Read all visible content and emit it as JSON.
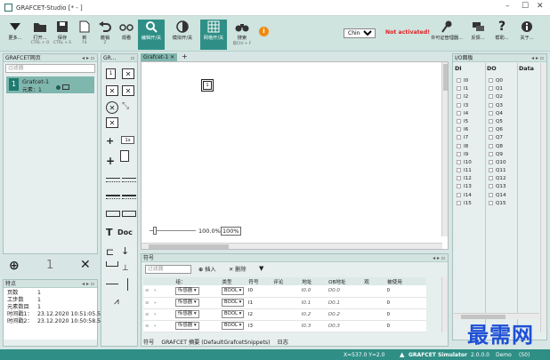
{
  "window": {
    "title": "GRAFCET-Studio [* - ]"
  },
  "toolbar": {
    "more": "更多...",
    "open": "打开...",
    "open_sc": "CTRL + O",
    "save": "保存",
    "save_sc": "CTRL + S",
    "new": "新",
    "new_sc": "F4",
    "undo": "撤销",
    "undo_sc": "Z",
    "observe": "观看",
    "edit_toggle": "编辑开/关",
    "sim_toggle": "模拟开/关",
    "grid_toggle": "网格开/关",
    "search": "搜索",
    "search_sc": "取Ctrl + F",
    "info_badge": "i",
    "language": "Chinese",
    "not_activated": "Not activated!",
    "license": "许可证管理器...",
    "feedback": "反馈...",
    "help": "帮助...",
    "about": "关于..."
  },
  "left_panel": {
    "title": "GRAFCET网页",
    "filter_placeholder": "过滤器",
    "item_num": "1",
    "item_name": "Grafcet-1",
    "item_sub": "元素：1",
    "count": "1"
  },
  "props_panel": {
    "title": "特点",
    "rows": [
      {
        "k": "页数",
        "v": "1"
      },
      {
        "k": "工步数",
        "v": "1"
      },
      {
        "k": "元素数目",
        "v": "1"
      },
      {
        "k": "时间戳1：",
        "v": "23.12.2020 10:51:05.5"
      },
      {
        "k": "时间戳2：",
        "v": "23.12.2020 10:50:58.5"
      }
    ]
  },
  "palette": {
    "title": "GR...",
    "step": "1",
    "doc": "Doc",
    "ts": "1s"
  },
  "editor": {
    "tab": "Grafcet-1",
    "add_tab": "+",
    "step_num": "1",
    "zoom": "100.0%",
    "zoom_btn": "100%"
  },
  "io_panel": {
    "title": "I/O面板",
    "di_header": "DI",
    "do_header": "DO",
    "data_header": "Data",
    "di": [
      "I0",
      "I1",
      "I2",
      "I3",
      "I4",
      "I5",
      "I6",
      "I7",
      "I8",
      "I9",
      "I10",
      "I11",
      "I12",
      "I13",
      "I14",
      "I15"
    ],
    "do": [
      "Q0",
      "Q1",
      "Q2",
      "Q3",
      "Q4",
      "Q5",
      "Q6",
      "Q7",
      "Q8",
      "Q9",
      "Q10",
      "Q11",
      "Q12",
      "Q13",
      "Q14",
      "Q15"
    ]
  },
  "symbols": {
    "title": "符号",
    "filter_placeholder": "过滤器",
    "insert": "插入",
    "delete": "删除",
    "headers": [
      "组：",
      "类型",
      "符号",
      "评论",
      "地址",
      "OB地址",
      "观",
      "被使用"
    ],
    "rows": [
      {
        "group": "传感器",
        "type": "BOOL",
        "sym": "I0",
        "addr": "I0.0",
        "ob": "O0.0",
        "used": "0"
      },
      {
        "group": "传感器",
        "type": "BOOL",
        "sym": "I1",
        "addr": "I0.1",
        "ob": "O0.1",
        "used": "0"
      },
      {
        "group": "传感器",
        "type": "BOOL",
        "sym": "I2",
        "addr": "I0.2",
        "ob": "O0.2",
        "used": "0"
      },
      {
        "group": "传感器",
        "type": "BOOL",
        "sym": "I3",
        "addr": "I0.3",
        "ob": "O0.3",
        "used": "0"
      }
    ],
    "tabs": [
      "符号",
      "GRAFCET 摘要 (DefaultGrafcetSnippets)",
      "日志"
    ]
  },
  "status": {
    "coords": "X=537.0  Y=2.0",
    "app": "GRAFCET Simulator",
    "version": "2.0.0.0",
    "demo": "Demo",
    "count": "(50)"
  },
  "watermark": "最需网",
  "colors": {
    "accent": "#2f8f86",
    "toolbar": "#cfe3df",
    "panel": "#e6efee",
    "warning": "#e02020",
    "info_badge": "#f08a10"
  }
}
